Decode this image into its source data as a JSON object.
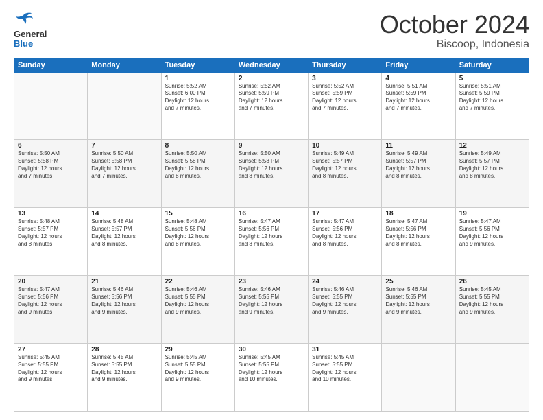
{
  "logo": {
    "text_general": "General",
    "text_blue": "Blue"
  },
  "header": {
    "title": "October 2024",
    "subtitle": "Biscoop, Indonesia"
  },
  "weekdays": [
    "Sunday",
    "Monday",
    "Tuesday",
    "Wednesday",
    "Thursday",
    "Friday",
    "Saturday"
  ],
  "weeks": [
    [
      {
        "day": "",
        "info": ""
      },
      {
        "day": "",
        "info": ""
      },
      {
        "day": "1",
        "info": "Sunrise: 5:52 AM\nSunset: 6:00 PM\nDaylight: 12 hours\nand 7 minutes."
      },
      {
        "day": "2",
        "info": "Sunrise: 5:52 AM\nSunset: 5:59 PM\nDaylight: 12 hours\nand 7 minutes."
      },
      {
        "day": "3",
        "info": "Sunrise: 5:52 AM\nSunset: 5:59 PM\nDaylight: 12 hours\nand 7 minutes."
      },
      {
        "day": "4",
        "info": "Sunrise: 5:51 AM\nSunset: 5:59 PM\nDaylight: 12 hours\nand 7 minutes."
      },
      {
        "day": "5",
        "info": "Sunrise: 5:51 AM\nSunset: 5:59 PM\nDaylight: 12 hours\nand 7 minutes."
      }
    ],
    [
      {
        "day": "6",
        "info": "Sunrise: 5:50 AM\nSunset: 5:58 PM\nDaylight: 12 hours\nand 7 minutes."
      },
      {
        "day": "7",
        "info": "Sunrise: 5:50 AM\nSunset: 5:58 PM\nDaylight: 12 hours\nand 7 minutes."
      },
      {
        "day": "8",
        "info": "Sunrise: 5:50 AM\nSunset: 5:58 PM\nDaylight: 12 hours\nand 8 minutes."
      },
      {
        "day": "9",
        "info": "Sunrise: 5:50 AM\nSunset: 5:58 PM\nDaylight: 12 hours\nand 8 minutes."
      },
      {
        "day": "10",
        "info": "Sunrise: 5:49 AM\nSunset: 5:57 PM\nDaylight: 12 hours\nand 8 minutes."
      },
      {
        "day": "11",
        "info": "Sunrise: 5:49 AM\nSunset: 5:57 PM\nDaylight: 12 hours\nand 8 minutes."
      },
      {
        "day": "12",
        "info": "Sunrise: 5:49 AM\nSunset: 5:57 PM\nDaylight: 12 hours\nand 8 minutes."
      }
    ],
    [
      {
        "day": "13",
        "info": "Sunrise: 5:48 AM\nSunset: 5:57 PM\nDaylight: 12 hours\nand 8 minutes."
      },
      {
        "day": "14",
        "info": "Sunrise: 5:48 AM\nSunset: 5:57 PM\nDaylight: 12 hours\nand 8 minutes."
      },
      {
        "day": "15",
        "info": "Sunrise: 5:48 AM\nSunset: 5:56 PM\nDaylight: 12 hours\nand 8 minutes."
      },
      {
        "day": "16",
        "info": "Sunrise: 5:47 AM\nSunset: 5:56 PM\nDaylight: 12 hours\nand 8 minutes."
      },
      {
        "day": "17",
        "info": "Sunrise: 5:47 AM\nSunset: 5:56 PM\nDaylight: 12 hours\nand 8 minutes."
      },
      {
        "day": "18",
        "info": "Sunrise: 5:47 AM\nSunset: 5:56 PM\nDaylight: 12 hours\nand 8 minutes."
      },
      {
        "day": "19",
        "info": "Sunrise: 5:47 AM\nSunset: 5:56 PM\nDaylight: 12 hours\nand 9 minutes."
      }
    ],
    [
      {
        "day": "20",
        "info": "Sunrise: 5:47 AM\nSunset: 5:56 PM\nDaylight: 12 hours\nand 9 minutes."
      },
      {
        "day": "21",
        "info": "Sunrise: 5:46 AM\nSunset: 5:56 PM\nDaylight: 12 hours\nand 9 minutes."
      },
      {
        "day": "22",
        "info": "Sunrise: 5:46 AM\nSunset: 5:55 PM\nDaylight: 12 hours\nand 9 minutes."
      },
      {
        "day": "23",
        "info": "Sunrise: 5:46 AM\nSunset: 5:55 PM\nDaylight: 12 hours\nand 9 minutes."
      },
      {
        "day": "24",
        "info": "Sunrise: 5:46 AM\nSunset: 5:55 PM\nDaylight: 12 hours\nand 9 minutes."
      },
      {
        "day": "25",
        "info": "Sunrise: 5:46 AM\nSunset: 5:55 PM\nDaylight: 12 hours\nand 9 minutes."
      },
      {
        "day": "26",
        "info": "Sunrise: 5:45 AM\nSunset: 5:55 PM\nDaylight: 12 hours\nand 9 minutes."
      }
    ],
    [
      {
        "day": "27",
        "info": "Sunrise: 5:45 AM\nSunset: 5:55 PM\nDaylight: 12 hours\nand 9 minutes."
      },
      {
        "day": "28",
        "info": "Sunrise: 5:45 AM\nSunset: 5:55 PM\nDaylight: 12 hours\nand 9 minutes."
      },
      {
        "day": "29",
        "info": "Sunrise: 5:45 AM\nSunset: 5:55 PM\nDaylight: 12 hours\nand 9 minutes."
      },
      {
        "day": "30",
        "info": "Sunrise: 5:45 AM\nSunset: 5:55 PM\nDaylight: 12 hours\nand 10 minutes."
      },
      {
        "day": "31",
        "info": "Sunrise: 5:45 AM\nSunset: 5:55 PM\nDaylight: 12 hours\nand 10 minutes."
      },
      {
        "day": "",
        "info": ""
      },
      {
        "day": "",
        "info": ""
      }
    ]
  ]
}
